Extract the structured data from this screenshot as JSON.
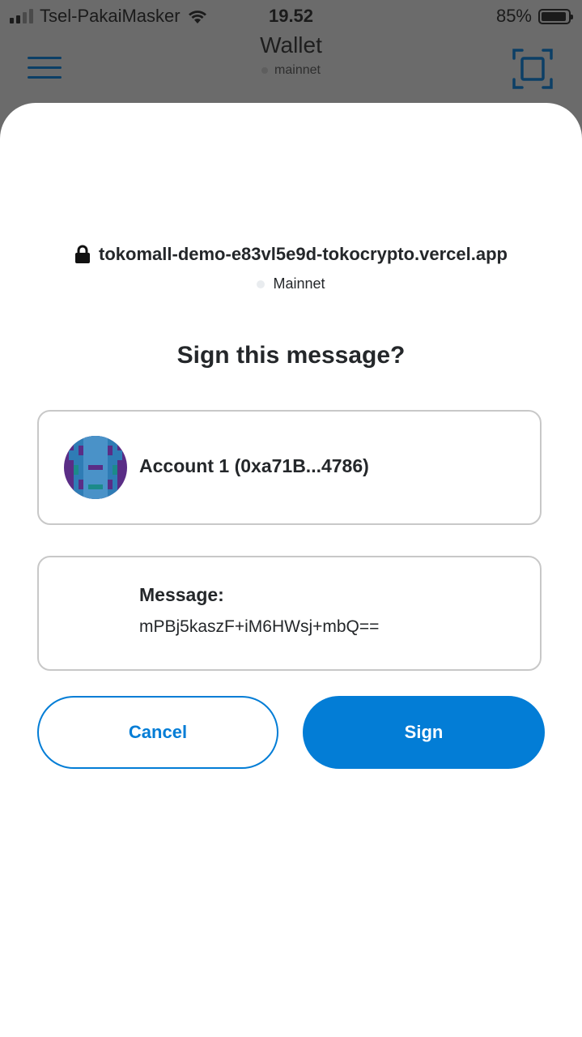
{
  "status_bar": {
    "carrier": "Tsel-PakaiMasker",
    "time": "19.52",
    "battery": "85%"
  },
  "background_nav": {
    "title": "Wallet",
    "network": "mainnet",
    "icons": [
      "hamburger-menu-icon",
      "scan-qr-icon"
    ]
  },
  "sheet": {
    "origin": "tokomall-demo-e83vl5e9d-tokocrypto.vercel.app",
    "network": "Mainnet",
    "heading": "Sign this message?",
    "account": {
      "label": "Account 1 (0xa71B...4786)"
    },
    "message": {
      "label": "Message:",
      "value": "mPBj5kaszF+iM6HWsj+mbQ=="
    },
    "buttons": {
      "cancel": "Cancel",
      "sign": "Sign"
    }
  },
  "colors": {
    "accent": "#037dd6",
    "text": "#24272a",
    "border": "#c8c8c8",
    "overlay": "#6b6b6b"
  }
}
